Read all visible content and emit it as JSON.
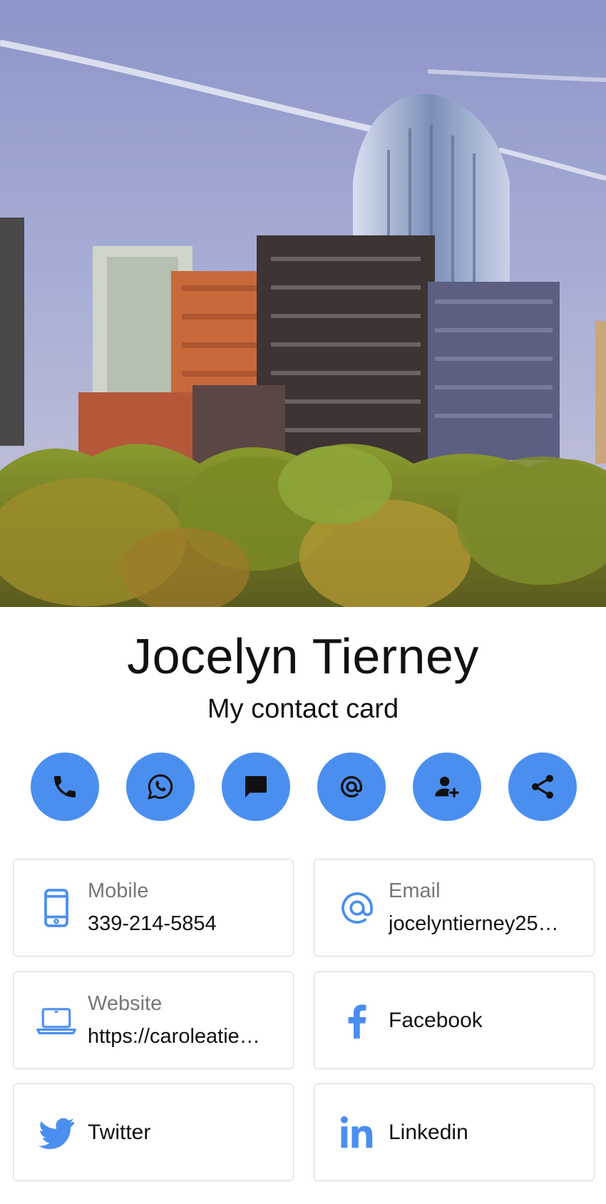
{
  "profile": {
    "name": "Jocelyn Tierney",
    "subtitle": "My contact card"
  },
  "actions": [
    {
      "icon": "phone-icon"
    },
    {
      "icon": "whatsapp-icon"
    },
    {
      "icon": "message-icon"
    },
    {
      "icon": "at-sign-icon"
    },
    {
      "icon": "add-contact-icon"
    },
    {
      "icon": "share-icon"
    }
  ],
  "contacts": {
    "mobile": {
      "label": "Mobile",
      "value": "339-214-5854",
      "icon": "mobile-phone-icon"
    },
    "email": {
      "label": "Email",
      "value": "jocelyntierney25…",
      "icon": "email-at-icon"
    },
    "website": {
      "label": "Website",
      "value": "https://caroleatie…",
      "icon": "laptop-icon"
    },
    "facebook": {
      "label": "Facebook",
      "icon": "facebook-icon"
    },
    "twitter": {
      "label": "Twitter",
      "icon": "twitter-icon"
    },
    "linkedin": {
      "label": "Linkedin",
      "icon": "linkedin-icon"
    }
  },
  "colors": {
    "accent": "#4a8ff0",
    "card_border": "#d8d8d8",
    "label_gray": "#777777"
  }
}
